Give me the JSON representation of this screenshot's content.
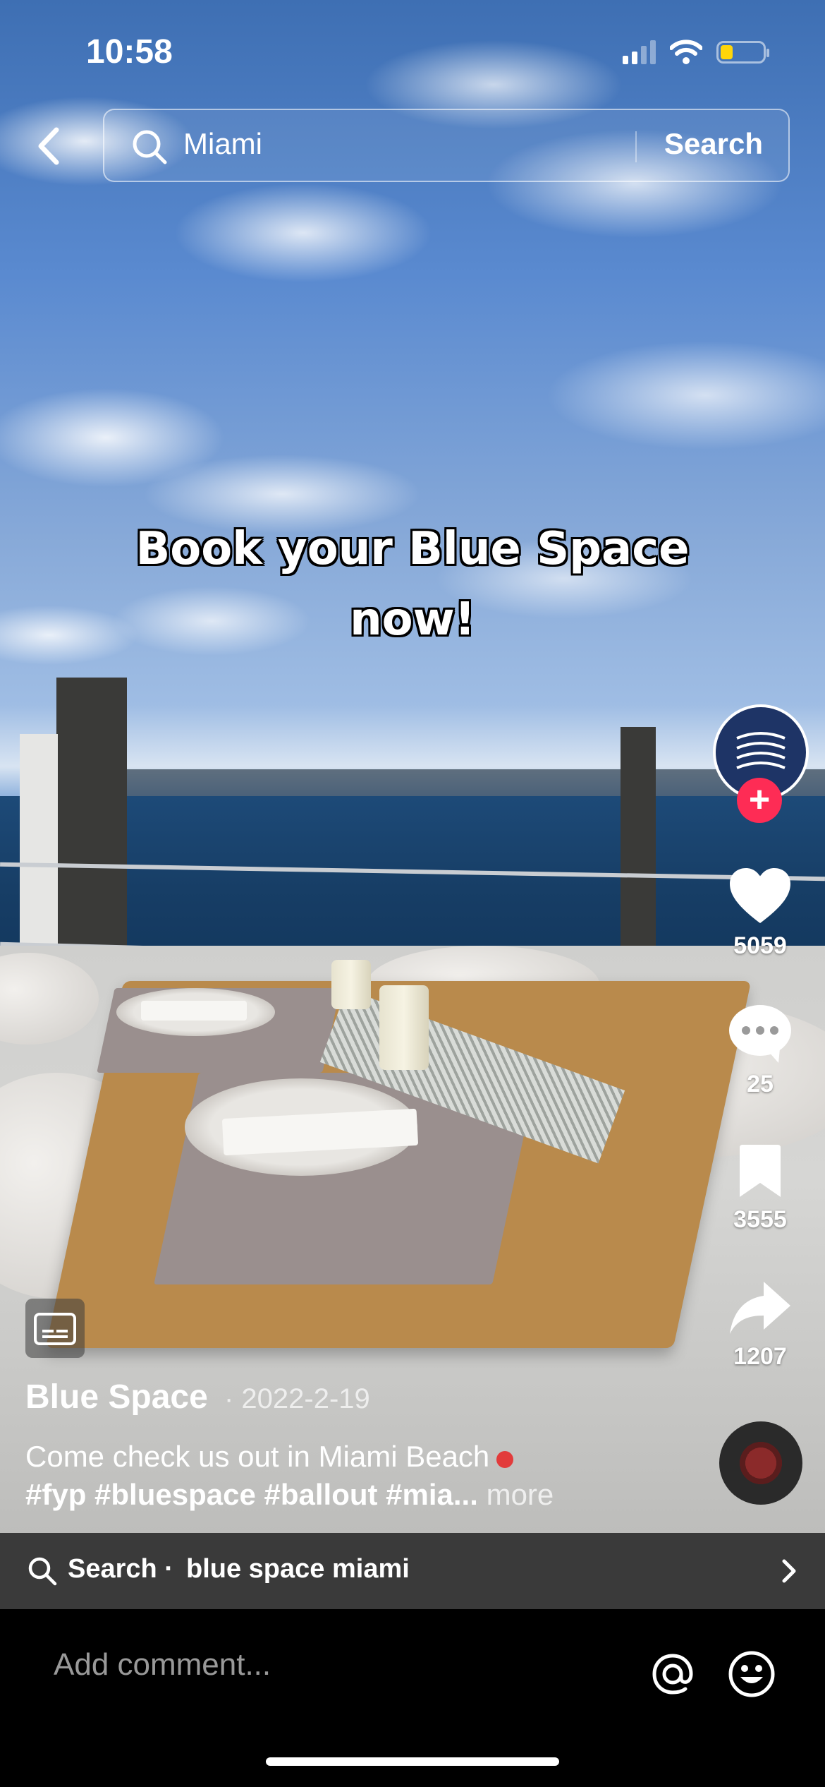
{
  "status_bar": {
    "time": "10:58",
    "battery_level": 0.3,
    "battery_color": "#ffd60a"
  },
  "search": {
    "back_icon": "chevron-left-icon",
    "query": "Miami",
    "button_label": "Search"
  },
  "video": {
    "overlay_line1": "Book your Blue Space",
    "overlay_line2": "now!"
  },
  "creator": {
    "avatar_icon": "waves-logo-icon",
    "follow_icon": "plus-icon"
  },
  "actions": {
    "likes": "5059",
    "comments": "25",
    "saves": "3555",
    "shares": "1207"
  },
  "post": {
    "author": "Blue Space",
    "date": "· 2022-2-19",
    "caption_line1": "Come check us out in Miami Beach",
    "caption_line2": "#fyp #bluespace #ballout #mia...",
    "more_label": "more"
  },
  "related_search": {
    "label": "Search ·",
    "term": "blue space miami"
  },
  "comment_bar": {
    "placeholder": "Add comment..."
  },
  "colors": {
    "accent": "#fe2c55",
    "avatar_bg": "#1e3466"
  }
}
